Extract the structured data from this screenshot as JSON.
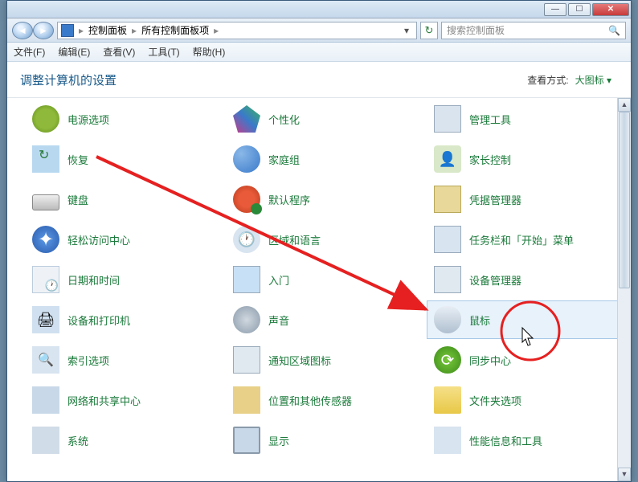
{
  "window": {
    "controls": {
      "min": "—",
      "max": "☐",
      "close": "✕"
    }
  },
  "addressbar": {
    "back": "◄",
    "forward": "►",
    "segments": [
      "控制面板",
      "所有控制面板项"
    ],
    "sep": "▸",
    "dropdown": "▾",
    "refresh": "↻"
  },
  "search": {
    "placeholder": "搜索控制面板",
    "icon": "🔍"
  },
  "menu": {
    "file": "文件(F)",
    "edit": "编辑(E)",
    "view": "查看(V)",
    "tools": "工具(T)",
    "help": "帮助(H)"
  },
  "header": {
    "title": "调整计算机的设置",
    "viewby_label": "查看方式:",
    "viewby_value": "大图标",
    "viewby_arrow": "▾"
  },
  "items": [
    {
      "name": "power-options",
      "label": "电源选项"
    },
    {
      "name": "personalization",
      "label": "个性化"
    },
    {
      "name": "admin-tools",
      "label": "管理工具"
    },
    {
      "name": "recovery",
      "label": "恢复"
    },
    {
      "name": "homegroup",
      "label": "家庭组"
    },
    {
      "name": "parental-controls",
      "label": "家长控制"
    },
    {
      "name": "keyboard",
      "label": "键盘"
    },
    {
      "name": "default-programs",
      "label": "默认程序"
    },
    {
      "name": "credential-manager",
      "label": "凭据管理器"
    },
    {
      "name": "ease-of-access",
      "label": "轻松访问中心"
    },
    {
      "name": "region-language",
      "label": "区域和语言"
    },
    {
      "name": "taskbar-start",
      "label": "任务栏和「开始」菜单"
    },
    {
      "name": "date-time",
      "label": "日期和时间"
    },
    {
      "name": "getting-started",
      "label": "入门"
    },
    {
      "name": "device-manager",
      "label": "设备管理器"
    },
    {
      "name": "devices-printers",
      "label": "设备和打印机"
    },
    {
      "name": "sound",
      "label": "声音"
    },
    {
      "name": "mouse",
      "label": "鼠标",
      "highlight": true
    },
    {
      "name": "indexing-options",
      "label": "索引选项"
    },
    {
      "name": "notification-icons",
      "label": "通知区域图标"
    },
    {
      "name": "sync-center",
      "label": "同步中心"
    },
    {
      "name": "network-sharing",
      "label": "网络和共享中心"
    },
    {
      "name": "location-sensors",
      "label": "位置和其他传感器"
    },
    {
      "name": "folder-options",
      "label": "文件夹选项"
    },
    {
      "name": "system",
      "label": "系统"
    },
    {
      "name": "display",
      "label": "显示"
    },
    {
      "name": "performance-tools",
      "label": "性能信息和工具"
    }
  ],
  "icon_classes": {
    "power-options": "ic-power",
    "personalization": "ic-personalize",
    "admin-tools": "ic-admin",
    "recovery": "ic-recovery",
    "homegroup": "ic-homegroup",
    "parental-controls": "ic-parental",
    "keyboard": "ic-keyboard",
    "default-programs": "ic-default",
    "credential-manager": "ic-cred",
    "ease-of-access": "ic-ease",
    "region-language": "ic-region",
    "taskbar-start": "ic-taskbar",
    "date-time": "ic-date",
    "getting-started": "ic-getstarted",
    "device-manager": "ic-devmgr",
    "devices-printers": "ic-devprint",
    "sound": "ic-sound",
    "mouse": "ic-mouse",
    "indexing-options": "ic-index",
    "notification-icons": "ic-tray",
    "sync-center": "ic-sync",
    "network-sharing": "ic-network",
    "location-sensors": "ic-location",
    "folder-options": "ic-folder",
    "system": "ic-system",
    "display": "ic-display",
    "performance-tools": "ic-perf"
  },
  "scrollbar": {
    "up": "▲",
    "down": "▼"
  }
}
